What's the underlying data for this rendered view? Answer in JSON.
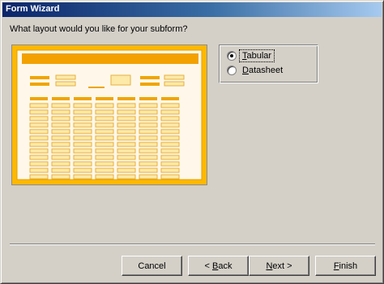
{
  "window": {
    "title": "Form Wizard"
  },
  "prompt": "What layout would you like for your subform?",
  "layout_options": {
    "selected": "Tabular",
    "items": [
      {
        "accel": "T",
        "rest": "abular",
        "checked": true
      },
      {
        "accel": "D",
        "rest": "atasheet",
        "checked": false
      }
    ]
  },
  "buttons": {
    "cancel": "Cancel",
    "back_prefix": "< ",
    "back_accel": "B",
    "back_rest": "ack",
    "next_accel": "N",
    "next_rest": "ext >",
    "finish_accel": "F",
    "finish_rest": "inish"
  },
  "colors": {
    "title_start": "#0a246a",
    "title_end": "#a6caf0",
    "dialog_bg": "#d4d0c8",
    "preview_frame": "#ffb800",
    "preview_bar": "#f2a100",
    "preview_field": "#fde9a8",
    "preview_paper": "#fff8ea"
  },
  "preview_icon": "tabular-layout-illustration"
}
